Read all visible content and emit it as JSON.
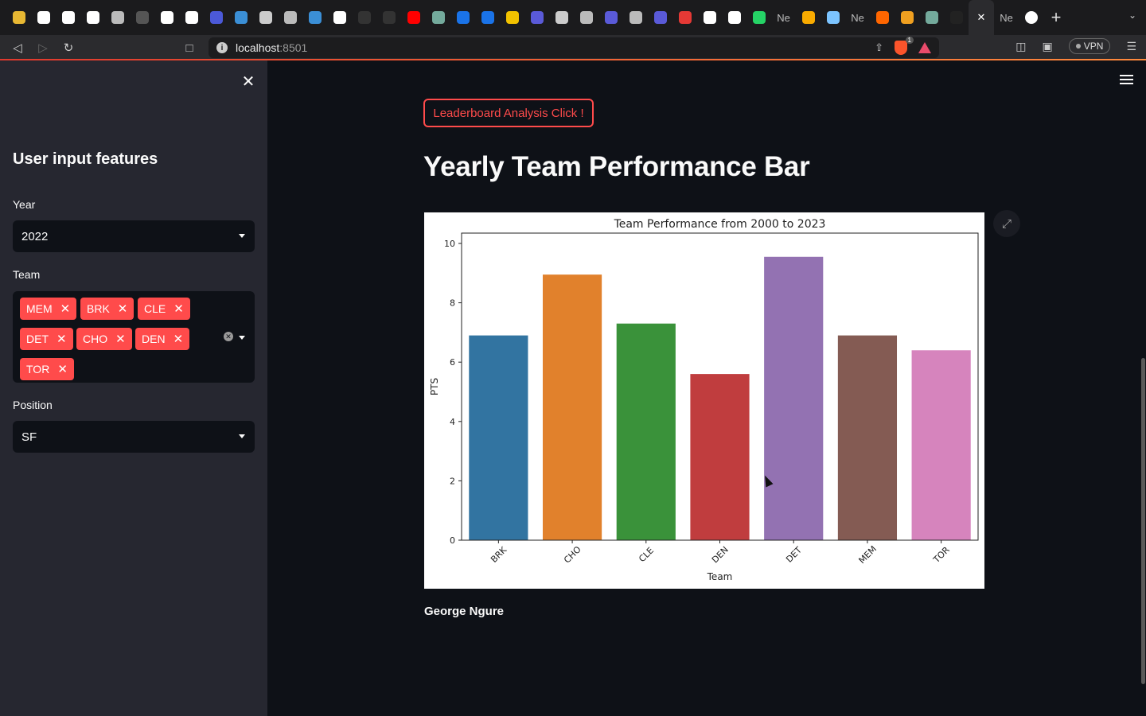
{
  "browser": {
    "tabs": [
      {
        "icon": "chrome-color-icon",
        "color": "#e8b833"
      },
      {
        "icon": "github-icon",
        "color": "#ffffff"
      },
      {
        "icon": "wikipedia-icon",
        "color": "#ffffff"
      },
      {
        "icon": "f-icon",
        "color": "#ffffff"
      },
      {
        "icon": "globe-icon",
        "color": "#bbbbbb"
      },
      {
        "icon": "github-dim-icon",
        "color": "#555555"
      },
      {
        "icon": "circle-play-icon",
        "color": "#ffffff"
      },
      {
        "icon": "circle-play-icon",
        "color": "#ffffff"
      },
      {
        "icon": "feather-icon",
        "color": "#4b59d8"
      },
      {
        "icon": "cnd-icon",
        "color": "#3b8fd6"
      },
      {
        "icon": "book-icon",
        "color": "#cccccc"
      },
      {
        "icon": "globe-icon",
        "color": "#bbbbbb"
      },
      {
        "icon": "k-icon",
        "color": "#3b8fd6"
      },
      {
        "icon": "google-icon",
        "color": "#ffffff"
      },
      {
        "icon": "kyd-icon",
        "color": "#333333"
      },
      {
        "icon": "kyd-icon",
        "color": "#333333"
      },
      {
        "icon": "youtube-icon",
        "color": "#ff0000"
      },
      {
        "icon": "chatgpt-icon",
        "color": "#74aa9c"
      },
      {
        "icon": "c-icon",
        "color": "#1a73e8"
      },
      {
        "icon": "c-icon",
        "color": "#1a73e8"
      },
      {
        "icon": "bulb-icon",
        "color": "#f2c200"
      },
      {
        "icon": "spiral-icon",
        "color": "#5a5ad8"
      },
      {
        "icon": "bars-icon",
        "color": "#cccccc"
      },
      {
        "icon": "globe-icon",
        "color": "#bbbbbb"
      },
      {
        "icon": "spiral-icon",
        "color": "#5a5ad8"
      },
      {
        "icon": "globe-icon",
        "color": "#bbbbbb"
      },
      {
        "icon": "spiral-icon",
        "color": "#5a5ad8"
      },
      {
        "icon": "download-icon",
        "color": "#e53935"
      },
      {
        "icon": "google-icon",
        "color": "#ffffff"
      },
      {
        "icon": "google-icon",
        "color": "#ffffff"
      },
      {
        "icon": "whatsapp-icon",
        "color": "#25d366"
      },
      {
        "icon": "text-tab",
        "text": "Ne"
      },
      {
        "icon": "colab-icon",
        "color": "#f9ab00"
      },
      {
        "icon": "swirl-icon",
        "color": "#7cc4ff"
      },
      {
        "icon": "text-tab",
        "text": "Ne"
      },
      {
        "icon": "arc-icon",
        "color": "#ff6600"
      },
      {
        "icon": "note-icon",
        "color": "#f0a020"
      },
      {
        "icon": "chatgpt-icon",
        "color": "#74aa9c"
      },
      {
        "icon": "gear-dark-icon",
        "color": "#222222"
      }
    ],
    "active_tab_close": "✕",
    "after_active": {
      "text": "Ne"
    },
    "url_host": "localhost",
    "url_port": ":8501",
    "brave_badge": "1",
    "vpn_label": "VPN"
  },
  "sidebar": {
    "title": "User input features",
    "year_label": "Year",
    "year_value": "2022",
    "team_label": "Team",
    "teams": [
      "MEM",
      "BRK",
      "CLE",
      "DET",
      "CHO",
      "DEN",
      "TOR"
    ],
    "position_label": "Position",
    "position_value": "SF"
  },
  "main": {
    "button_label": "Leaderboard Analysis Click !",
    "title": "Yearly Team Performance Bar",
    "author": "George Ngure"
  },
  "chart_data": {
    "type": "bar",
    "title": "Team Performance from 2000 to 2023",
    "xlabel": "Team",
    "ylabel": "PTS",
    "categories": [
      "BRK",
      "CHO",
      "CLE",
      "DEN",
      "DET",
      "MEM",
      "TOR"
    ],
    "values": [
      6.9,
      8.95,
      7.3,
      5.6,
      9.55,
      6.9,
      6.4
    ],
    "colors": [
      "#3274a1",
      "#e1812c",
      "#3a923a",
      "#c03d3e",
      "#9372b2",
      "#845b53",
      "#d684bd"
    ],
    "ylim": [
      0,
      10
    ],
    "yticks": [
      0,
      2,
      4,
      6,
      8,
      10
    ],
    "grid": false
  }
}
